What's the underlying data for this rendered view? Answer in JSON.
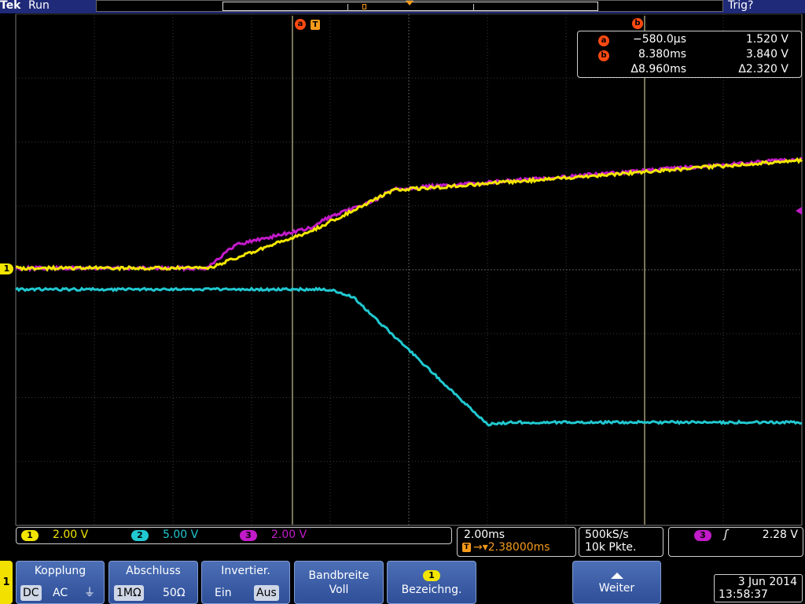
{
  "header": {
    "brand": "Tek",
    "run_status": "Run",
    "trigger_status": "Trig?"
  },
  "colors": {
    "ch1": "#f2e600",
    "ch2": "#21c8d0",
    "ch3": "#c21bc9",
    "cursor_marker": "#ff4a12",
    "trigger": "#f59a1a",
    "menu_blue": "#3c5ea8"
  },
  "cursor_readout": {
    "a": {
      "label": "a",
      "time": "−580.0µs",
      "value": "1.520 V"
    },
    "b": {
      "label": "b",
      "time": "8.380ms",
      "value": "3.840 V"
    },
    "delta": {
      "time": "Δ8.960ms",
      "value": "Δ2.320 V"
    }
  },
  "markers": {
    "cursor_a": "a",
    "cursor_b": "b",
    "trigger": "T",
    "ch1_ground": "1"
  },
  "channels": [
    {
      "chip": "1",
      "scale": "2.00 V"
    },
    {
      "chip": "2",
      "scale": "5.00 V"
    },
    {
      "chip": "3",
      "scale": "2.00 V"
    }
  ],
  "timebase": {
    "scale": "2.00ms",
    "position": "→▾2.38000ms",
    "trigger_icon": "T"
  },
  "acquisition": {
    "sample_rate": "500kS/s",
    "record_length": "10k Pkte."
  },
  "trigger": {
    "source": "3",
    "slope": "ʃ",
    "level": "2.28 V"
  },
  "menu": {
    "channel": "1",
    "kopplung": {
      "label": "Kopplung",
      "options": [
        "DC",
        "AC",
        "⏚"
      ],
      "selected": "DC"
    },
    "abschluss": {
      "label": "Abschluss",
      "options": [
        "1MΩ",
        "50Ω"
      ],
      "selected": "1MΩ"
    },
    "invertier": {
      "label": "Invertier.",
      "options": [
        "Ein",
        "Aus"
      ],
      "selected": "Aus"
    },
    "bandbreite": {
      "label": "Bandbreite",
      "value": "Voll"
    },
    "bezeichnung": {
      "chip": "1",
      "label": "Bezeichng."
    },
    "weiter": {
      "label": "Weiter"
    }
  },
  "datetime": {
    "date": "3 Jun 2014",
    "time": "13:58:37"
  }
}
